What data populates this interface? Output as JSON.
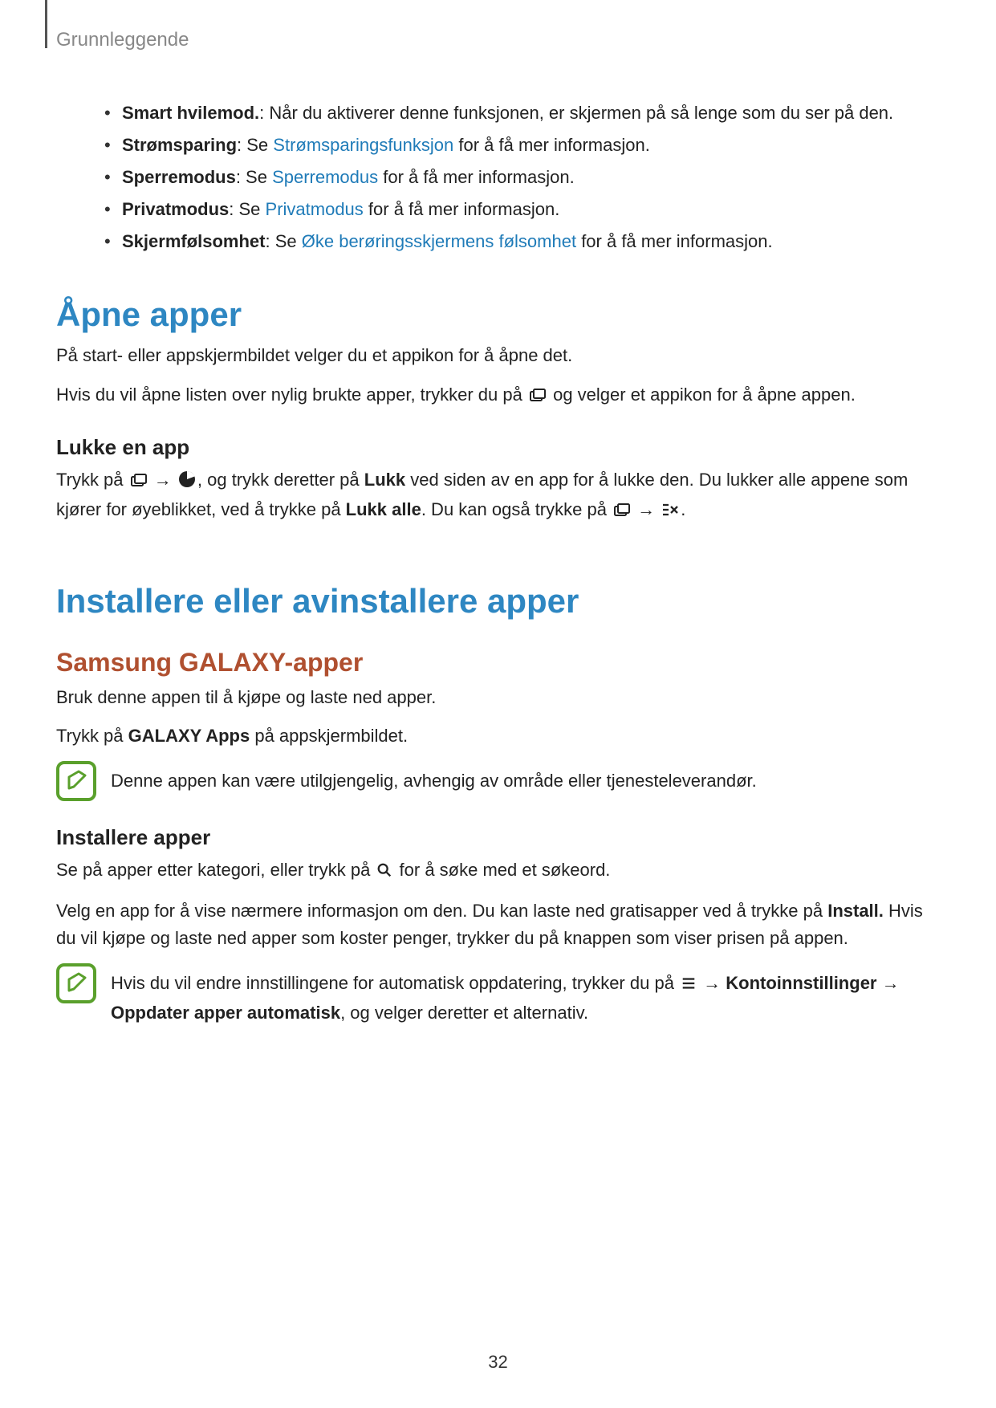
{
  "header": {
    "section": "Grunnleggende"
  },
  "bullets": [
    {
      "bold": "Smart hvilemod.",
      "after1": ": Når du aktiverer denne funksjonen, er skjermen på så lenge som du ser på den."
    },
    {
      "bold": "Strømsparing",
      "after1": ": Se ",
      "link": "Strømsparingsfunksjon",
      "after2": " for å få mer informasjon."
    },
    {
      "bold": "Sperremodus",
      "after1": ": Se ",
      "link": "Sperremodus",
      "after2": " for å få mer informasjon."
    },
    {
      "bold": "Privatmodus",
      "after1": ": Se ",
      "link": "Privatmodus",
      "after2": " for å få mer informasjon."
    },
    {
      "bold": "Skjermfølsomhet",
      "after1": ": Se ",
      "link": "Øke berøringsskjermens følsomhet",
      "after2": " for å få mer informasjon."
    }
  ],
  "section_open": {
    "heading": "Åpne apper",
    "para1": "På start- eller appskjermbildet velger du et appikon for å åpne det.",
    "para2_a": "Hvis du vil åpne listen over nylig brukte apper, trykker du på ",
    "para2_b": " og velger et appikon for å åpne appen.",
    "sub_heading": "Lukke en app",
    "close_a": "Trykk på ",
    "close_arrow1": " → ",
    "close_b": ", og trykk deretter på ",
    "close_bold1": "Lukk",
    "close_c": " ved siden av en app for å lukke den. Du lukker alle appene som kjører for øyeblikket, ved å trykke på ",
    "close_bold2": "Lukk alle",
    "close_d": ". Du kan også trykke på ",
    "close_arrow2": " → ",
    "close_e": "."
  },
  "section_install": {
    "heading": "Installere eller avinstallere apper",
    "sub_heading": "Samsung GALAXY-apper",
    "para1": "Bruk denne appen til å kjøpe og laste ned apper.",
    "para2_a": "Trykk på ",
    "para2_bold": "GALAXY Apps",
    "para2_b": " på appskjermbildet.",
    "note1": "Denne appen kan være utilgjengelig, avhengig av område eller tjenesteleverandør.",
    "sub2_heading": "Installere apper",
    "browse_a": "Se på apper etter kategori, eller trykk på ",
    "browse_b": " for å søke med et søkeord.",
    "select_a": "Velg en app for å vise nærmere informasjon om den. Du kan laste ned gratisapper ved å trykke på ",
    "select_bold": "Install.",
    "select_b": " Hvis du vil kjøpe og laste ned apper som koster penger, trykker du på knappen som viser prisen på appen.",
    "note2_a": "Hvis du vil endre innstillingene for automatisk oppdatering, trykker du på ",
    "note2_arrow": " → ",
    "note2_bold1": "Kontoinnstillinger",
    "note2_arrow2": " → ",
    "note2_bold2": "Oppdater apper automatisk",
    "note2_b": ", og velger deretter et alternativ."
  },
  "page_number": "32"
}
